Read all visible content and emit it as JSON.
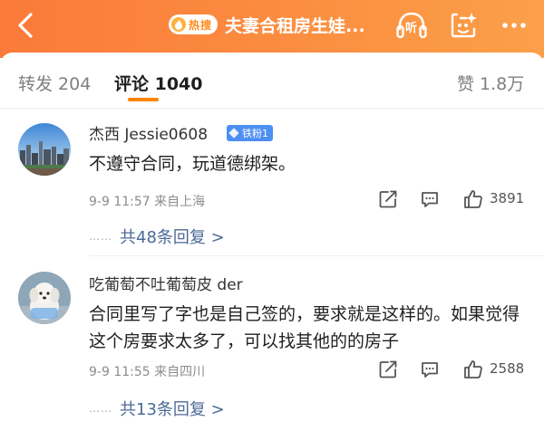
{
  "header": {
    "hot_badge": "热搜",
    "title": "夫妻合租房生娃...",
    "listen_label": "听"
  },
  "tabs": {
    "repost": "转发 204",
    "comments": "评论 1040",
    "likes": "赞 1.8万"
  },
  "comments": [
    {
      "username": "杰西 Jessie0608",
      "badge": "铁粉1",
      "text": "不遵守合同，玩道德绑架。",
      "time": "9-9 11:57",
      "location": "来自上海",
      "like_count": "3891",
      "dots": "……",
      "replies_label": "共48条回复 >"
    },
    {
      "username": "吃葡萄不吐葡萄皮 der",
      "text": "合同里写了字也是自己签的，要求就是这样的。如果觉得这个房要求太多了，可以找其他的的房子",
      "time": "9-9 11:55",
      "location": "来自四川",
      "like_count": "2588",
      "dots": "……",
      "replies_label": "共13条回复 >"
    }
  ],
  "colors": {
    "accent": "#ff8200",
    "header_gradient_start": "#fb7a3a",
    "header_gradient_end": "#fba049",
    "link": "#4c6a96",
    "badge": "#4d8ff3"
  }
}
